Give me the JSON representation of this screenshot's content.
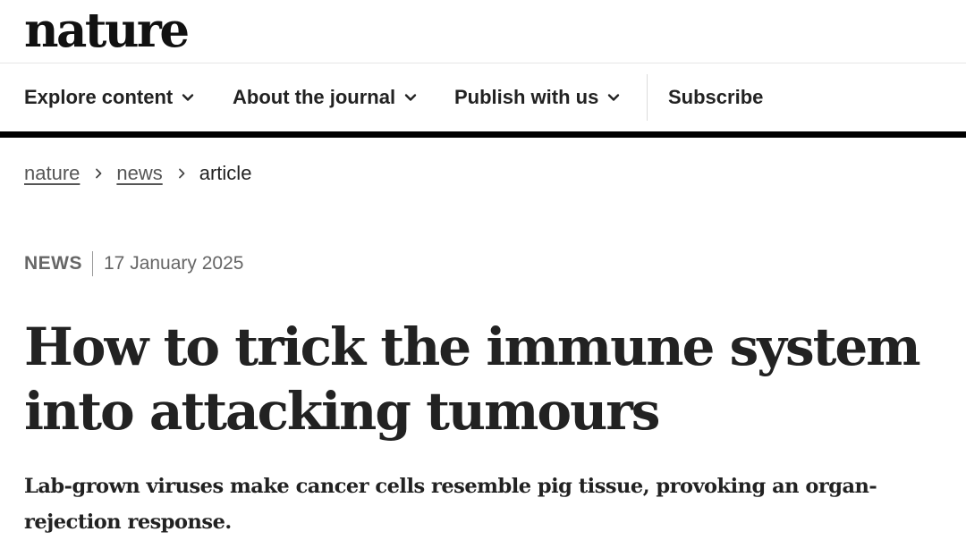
{
  "site": {
    "logo_text": "nature"
  },
  "nav": {
    "items": [
      {
        "label": "Explore content",
        "has_dropdown": true
      },
      {
        "label": "About the journal",
        "has_dropdown": true
      },
      {
        "label": "Publish with us",
        "has_dropdown": true
      },
      {
        "label": "Subscribe",
        "has_dropdown": false
      }
    ],
    "icons": {
      "dropdown": "chevron-down-icon"
    }
  },
  "breadcrumb": {
    "items": [
      {
        "label": "nature",
        "link": true
      },
      {
        "label": "news",
        "link": true
      },
      {
        "label": "article",
        "link": false
      }
    ],
    "separator_icon": "chevron-right-icon"
  },
  "article": {
    "type": "NEWS",
    "date": "17 January 2025",
    "title_line1": "How to trick the immune system",
    "title_line2": "into attacking tumours",
    "standfirst": "Lab-grown viruses make cancer cells resemble pig tissue, provoking an organ-rejection response."
  },
  "colors": {
    "text": "#222222",
    "muted": "#666666",
    "rule": "#000000"
  }
}
